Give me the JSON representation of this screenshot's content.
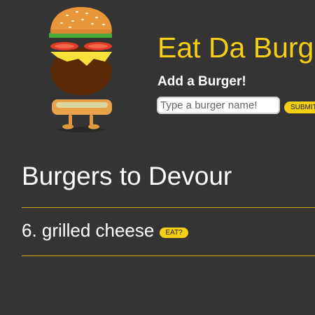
{
  "header": {
    "title": "Eat Da Burger!",
    "add_label": "Add a Burger!",
    "input": {
      "placeholder": "Type a burger name!",
      "value": ""
    },
    "submit_label": "SUBMIT"
  },
  "devour": {
    "title": "Burgers to Devour",
    "items": [
      {
        "label": "6. grilled cheese",
        "button_label": "EAT?"
      }
    ]
  },
  "colors": {
    "background": "#343434",
    "accent": "#f5cf14",
    "text": "#ffffff"
  },
  "icons": {
    "logo": "burger-mascot-icon"
  }
}
